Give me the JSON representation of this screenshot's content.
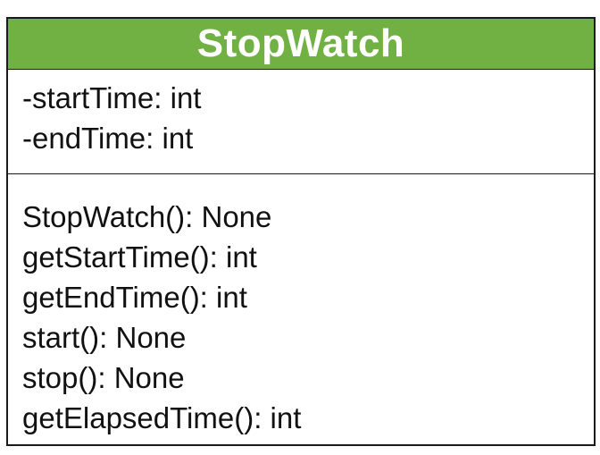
{
  "class": {
    "name": "StopWatch",
    "header_color": "#71b043",
    "attributes": [
      "-startTime: int",
      "-endTime: int"
    ],
    "methods": [
      "StopWatch(): None",
      "getStartTime(): int",
      "getEndTime(): int",
      "start(): None",
      "stop(): None",
      "getElapsedTime(): int"
    ]
  }
}
